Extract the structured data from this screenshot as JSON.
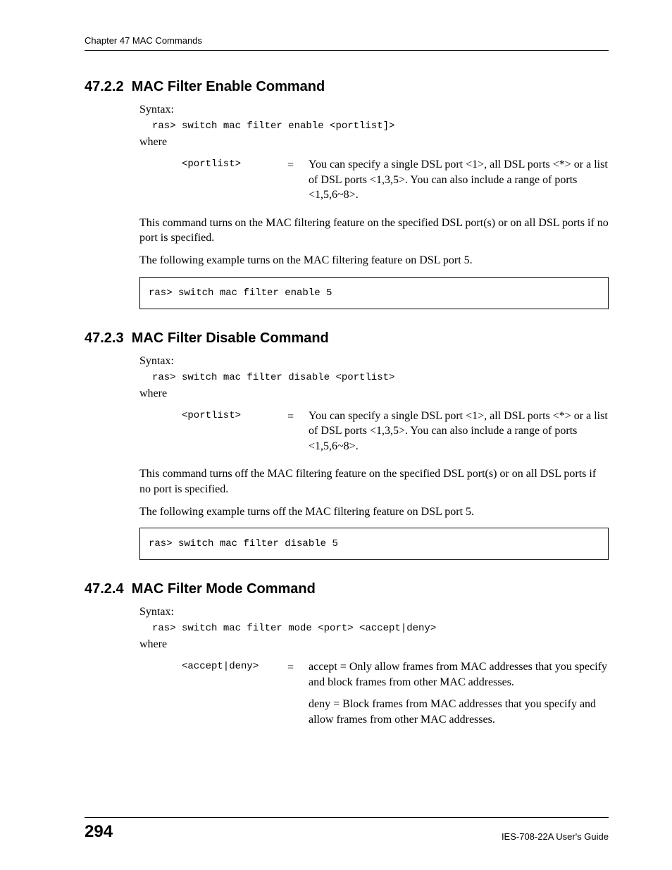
{
  "header": "Chapter 47 MAC Commands",
  "sections": [
    {
      "number": "47.2.2",
      "title": "MAC Filter Enable Command",
      "syntax_label": "Syntax:",
      "syntax_cmd": "ras> switch mac filter enable <portlist]>",
      "where": "where",
      "param_name": "<portlist>",
      "param_eq": "=",
      "param_desc": "You can specify a single DSL port <1>, all DSL ports <*> or a list of DSL ports <1,3,5>. You can also include a range of ports <1,5,6~8>.",
      "body1": "This command turns on the MAC filtering feature on the specified DSL port(s) or on all DSL ports if no port is specified.",
      "body2": "The following example turns on the MAC filtering feature on DSL port 5.",
      "example": "ras> switch mac filter enable 5"
    },
    {
      "number": "47.2.3",
      "title": "MAC Filter Disable Command",
      "syntax_label": "Syntax:",
      "syntax_cmd": "ras> switch mac filter disable <portlist>",
      "where": "where",
      "param_name": "<portlist>",
      "param_eq": "=",
      "param_desc": "You can specify a single DSL port <1>, all DSL ports <*> or a list of DSL ports <1,3,5>. You can also include a range of ports <1,5,6~8>.",
      "body1": "This command turns off the MAC filtering feature on the specified DSL port(s) or on all DSL ports if no port is specified.",
      "body2": "The following example turns off the MAC filtering feature on DSL port 5.",
      "example": "ras> switch mac filter disable 5"
    },
    {
      "number": "47.2.4",
      "title": "MAC Filter Mode Command",
      "syntax_label": "Syntax:",
      "syntax_cmd": "ras> switch mac filter mode <port> <accept|deny>",
      "where": "where",
      "param_name": "<accept|deny>",
      "param_eq": "=",
      "param_desc_1": "accept = Only allow frames from MAC addresses that you specify and block frames from other MAC addresses.",
      "param_desc_2": "deny = Block frames from MAC addresses that you specify and allow frames from other MAC addresses."
    }
  ],
  "footer": {
    "page": "294",
    "guide": "IES-708-22A User's Guide"
  }
}
